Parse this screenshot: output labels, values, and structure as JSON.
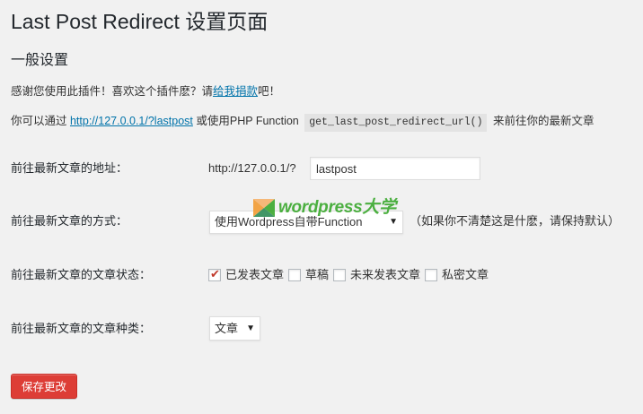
{
  "page": {
    "title": "Last Post Redirect 设置页面",
    "section_title": "一般设置",
    "thanks": {
      "before": "感谢您使用此插件！喜欢这个插件麽？请",
      "link": "给我捐款",
      "after": "吧！"
    },
    "info": {
      "before": "你可以通过 ",
      "url": "http://127.0.0.1/?lastpost",
      "middle": " 或使用PHP Function ",
      "function": "get_last_post_redirect_url()",
      "after": " 来前往你的最新文章"
    }
  },
  "form": {
    "url_row": {
      "label": "前往最新文章的地址：",
      "prefix": "http://127.0.0.1/?",
      "value": "lastpost"
    },
    "method_row": {
      "label": "前往最新文章的方式：",
      "selected": "使用Wordpress自带Function",
      "note": "（如果你不清楚这是什麽，请保持默认）"
    },
    "status_row": {
      "label": "前往最新文章的文章状态：",
      "options": [
        {
          "label": "已发表文章",
          "checked": true
        },
        {
          "label": "草稿",
          "checked": false
        },
        {
          "label": "未来发表文章",
          "checked": false
        },
        {
          "label": "私密文章",
          "checked": false
        }
      ]
    },
    "type_row": {
      "label": "前往最新文章的文章种类：",
      "selected": "文章"
    },
    "save_label": "保存更改"
  },
  "watermark": {
    "text": "wordpress大学"
  },
  "colors": {
    "background": "#f1f1f1",
    "link": "#0073aa",
    "button": "#dd3d36",
    "check": "#c0392b",
    "watermark": "#3aa82d"
  },
  "icons": {
    "dropdown": "triangle-down",
    "check": "checkmark"
  }
}
